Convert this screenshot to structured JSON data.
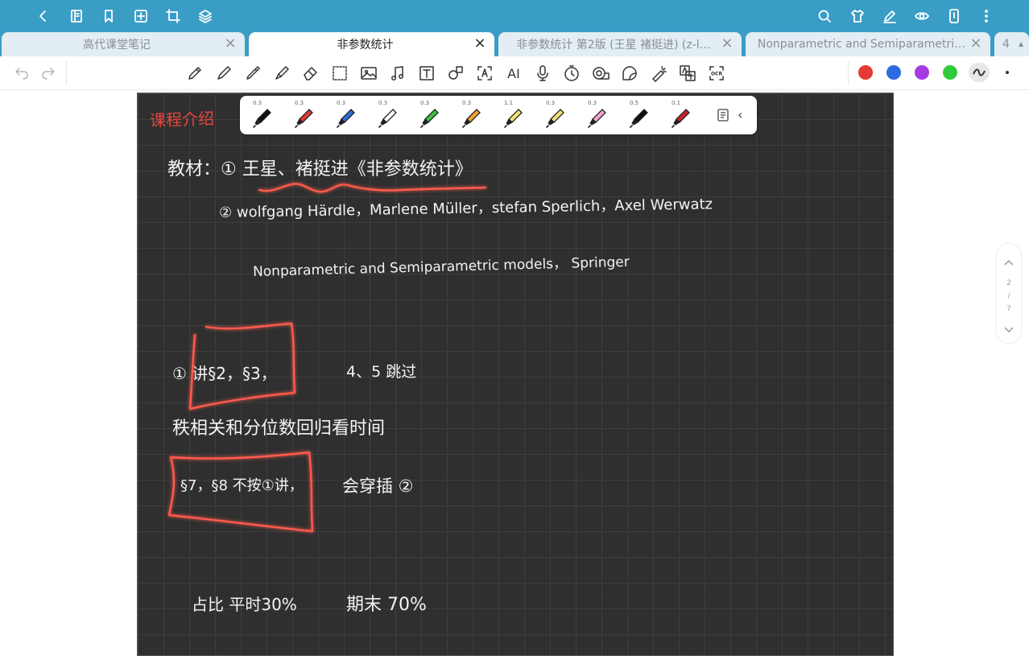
{
  "tabs": [
    {
      "label": "高代课堂笔记",
      "active": false
    },
    {
      "label": "非参数统计",
      "active": true
    },
    {
      "label": "非参数统计 第2版 (王星 褚挺进) (z-l…",
      "active": false
    },
    {
      "label": "Nonparametric and Semiparametri…",
      "active": false
    }
  ],
  "tab_count": "4",
  "top_icons_left": [
    "back-icon",
    "book-icon",
    "bookmark-icon",
    "add-page-icon",
    "crop-icon",
    "layers-icon"
  ],
  "top_icons_right": [
    "search-icon",
    "shirt-icon",
    "pen-edit-icon",
    "eye-icon",
    "phone-icon",
    "more-vert-icon"
  ],
  "tools": [
    "pencil",
    "fineliner",
    "pen",
    "brush",
    "eraser",
    "lasso",
    "image",
    "audio",
    "textbox",
    "shapes",
    "text-recognize",
    "ai",
    "microphone",
    "timer",
    "tape",
    "sticker",
    "laser",
    "translate",
    "ocr"
  ],
  "tool_labels": {
    "ai": "AI",
    "ocr": "OCR"
  },
  "colors": [
    "#e53935",
    "#2d6cdf",
    "#a43be3",
    "#2fcb3c"
  ],
  "palette": {
    "pens": [
      {
        "size": "0.3",
        "color": "#111111"
      },
      {
        "size": "0.3",
        "color": "#d93a3a"
      },
      {
        "size": "0.3",
        "color": "#2f6fd6"
      },
      {
        "size": "0.3",
        "color": "#ffffff"
      },
      {
        "size": "0.3",
        "color": "#3cc33c"
      },
      {
        "size": "0.3",
        "color": "#f0a23a"
      },
      {
        "size": "1.1",
        "color": "#f0e27a"
      },
      {
        "size": "0.3",
        "color": "#f0e27a"
      },
      {
        "size": "0.3",
        "color": "#f5a6cf"
      },
      {
        "size": "0.5",
        "color": "#111111"
      },
      {
        "size": "0.1",
        "color": "#c8232b"
      }
    ]
  },
  "note": {
    "title": "课程介绍",
    "line1": "教材：① 王星、褚挺进《非参数统计》",
    "line2": "② wolfgang  Härdle，Marlene   Müller，stefan  Sperlich，Axel   Werwatz",
    "line3": "Nonparametric and   Semiparametric   models，  Springer",
    "line4a": "① 讲§2，§3，",
    "line4b": "4、5 跳过",
    "line5": "秩相关和分位数回归看时间",
    "line6a": "§7，§8 不按①讲，",
    "line6b": "会穿插 ②",
    "line7a": "占比 平时30%",
    "line7b": "期末 70%"
  },
  "pager": {
    "current": "2",
    "sep": "/",
    "total": "7"
  }
}
